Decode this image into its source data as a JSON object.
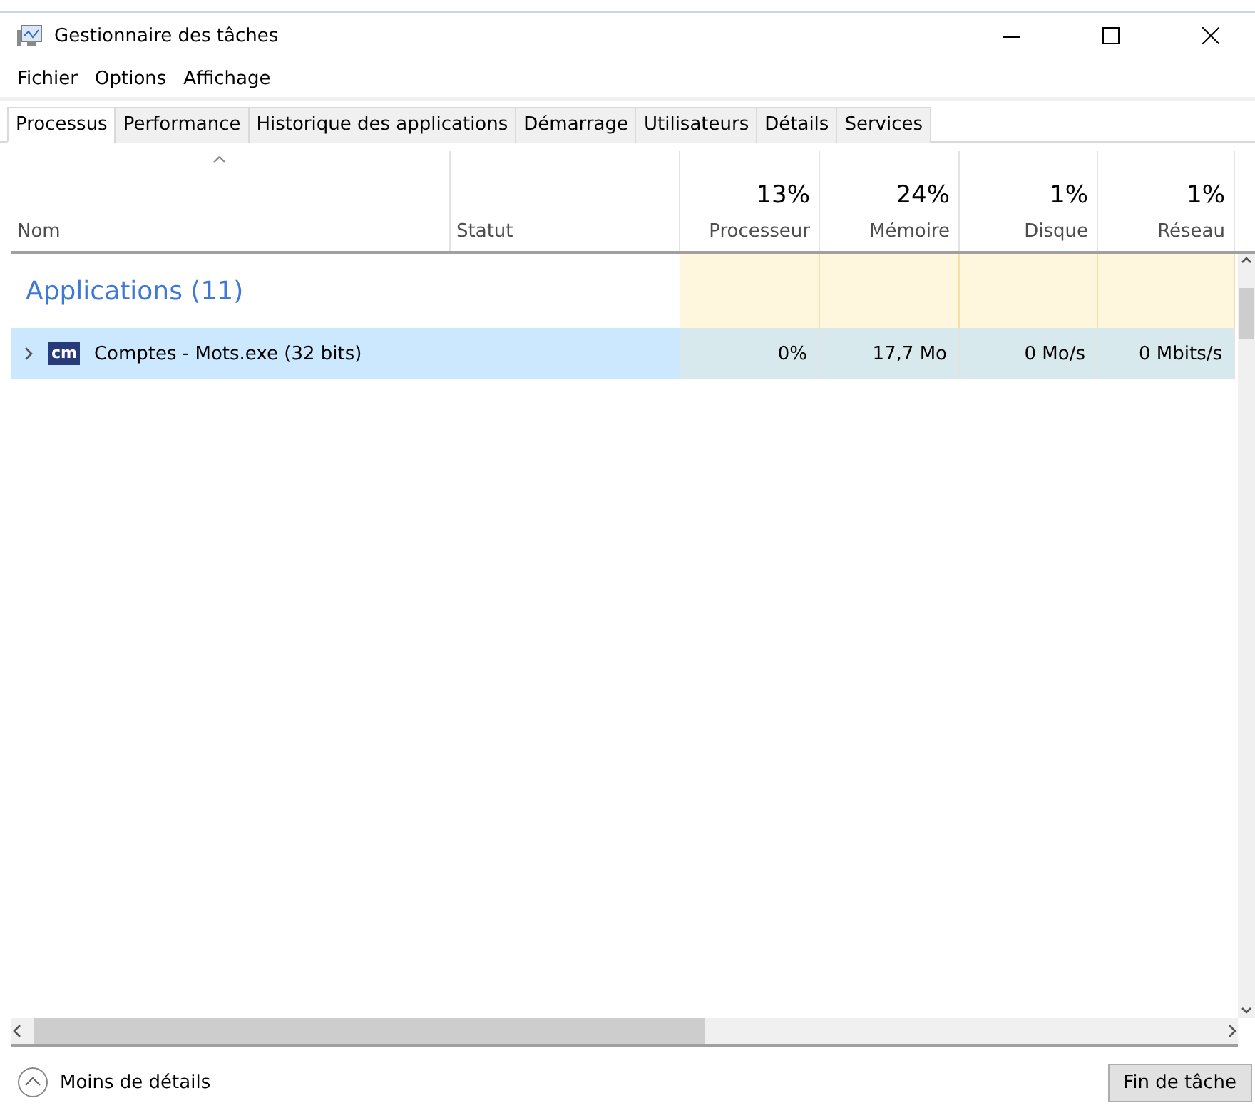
{
  "window": {
    "title": "Gestionnaire des tâches"
  },
  "menu": [
    "Fichier",
    "Options",
    "Affichage"
  ],
  "tabs": [
    {
      "label": "Processus",
      "selected": true
    },
    {
      "label": "Performance",
      "selected": false
    },
    {
      "label": "Historique des applications",
      "selected": false
    },
    {
      "label": "Démarrage",
      "selected": false
    },
    {
      "label": "Utilisateurs",
      "selected": false
    },
    {
      "label": "Détails",
      "selected": false
    },
    {
      "label": "Services",
      "selected": false
    }
  ],
  "table": {
    "sort_arrow": "^",
    "columns": [
      {
        "label": "Nom",
        "kind": "text"
      },
      {
        "label": "Statut",
        "kind": "text"
      },
      {
        "label": "Processeur",
        "kind": "metric",
        "usage": "13%"
      },
      {
        "label": "Mémoire",
        "kind": "metric",
        "usage": "24%"
      },
      {
        "label": "Disque",
        "kind": "metric",
        "usage": "1%"
      },
      {
        "label": "Réseau",
        "kind": "metric",
        "usage": "1%"
      }
    ],
    "groups": [
      {
        "title": "Applications (11)",
        "rows": [
          {
            "name": "Comptes - Mots.exe (32 bits)",
            "icon_text": "cm",
            "expanded": false,
            "selected": true,
            "status": "",
            "cells": [
              "0%",
              "17,7 Mo",
              "0 Mo/s",
              "0 Mbits/s"
            ]
          }
        ]
      }
    ]
  },
  "footer": {
    "toggle": "Moins de détails",
    "end_task": "Fin de tâche"
  }
}
